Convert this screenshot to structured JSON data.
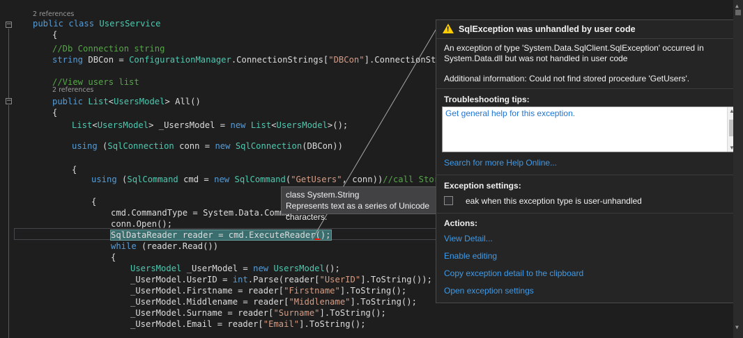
{
  "editor": {
    "ref_labels": [
      "2 references",
      "2 references"
    ],
    "lines": [
      [
        [
          "kw",
          "public class "
        ],
        [
          "ty",
          "UsersService"
        ]
      ],
      [
        [
          "",
          "{"
        ]
      ],
      [
        [
          "cm",
          "//Db Connection string"
        ]
      ],
      [
        [
          "kw",
          "string "
        ],
        [
          "",
          "DBCon = "
        ],
        [
          "ty",
          "ConfigurationManager"
        ],
        [
          "",
          ".ConnectionStrings["
        ],
        [
          "st",
          "\"DBCon\""
        ],
        [
          "",
          "].ConnectionString"
        ]
      ],
      [
        [
          "cm",
          "//View users list"
        ]
      ],
      [
        [
          "kw",
          "public "
        ],
        [
          "ty",
          "List"
        ],
        [
          "",
          "<"
        ],
        [
          "ty",
          "UsersModel"
        ],
        [
          "",
          "> All()"
        ]
      ],
      [
        [
          "",
          "{"
        ]
      ],
      [
        [
          "ty",
          "List"
        ],
        [
          "",
          "<"
        ],
        [
          "ty",
          "UsersModel"
        ],
        [
          "",
          "> _UsersModel = "
        ],
        [
          "kw",
          "new "
        ],
        [
          "ty",
          "List"
        ],
        [
          "",
          "<"
        ],
        [
          "ty",
          "UsersModel"
        ],
        [
          "",
          ">();"
        ]
      ],
      [
        [
          "kw",
          "using "
        ],
        [
          "",
          "("
        ],
        [
          "ty",
          "SqlConnection"
        ],
        [
          "",
          " conn = "
        ],
        [
          "kw",
          "new "
        ],
        [
          "ty",
          "SqlConnection"
        ],
        [
          "",
          "(DBCon))"
        ]
      ],
      [
        [
          "",
          "{"
        ]
      ],
      [
        [
          "kw",
          "using "
        ],
        [
          "",
          "("
        ],
        [
          "ty",
          "SqlCommand"
        ],
        [
          "",
          " cmd = "
        ],
        [
          "kw",
          "new "
        ],
        [
          "ty",
          "SqlCommand"
        ],
        [
          "",
          "("
        ],
        [
          "st",
          "\"GetUsers\""
        ],
        [
          "",
          ", conn))"
        ],
        [
          "cm",
          "//call Stored"
        ]
      ],
      [
        [
          "",
          "{"
        ]
      ],
      [
        [
          "",
          "cmd.CommandType = System.Data.Comma"
        ]
      ],
      [
        [
          "",
          "conn.Open();"
        ]
      ],
      [
        [
          "sel",
          "SqlDataReader reader = cmd.ExecuteReader();"
        ]
      ],
      [
        [
          "kw",
          "while "
        ],
        [
          "",
          "(reader.Read())"
        ]
      ],
      [
        [
          "",
          "{"
        ]
      ],
      [
        [
          "ty",
          "UsersModel"
        ],
        [
          "",
          " _UserModel = "
        ],
        [
          "kw",
          "new "
        ],
        [
          "ty",
          "UsersModel"
        ],
        [
          "",
          "();"
        ]
      ],
      [
        [
          "",
          "_UserModel.UserID = "
        ],
        [
          "kw",
          "int"
        ],
        [
          "",
          ".Parse(reader["
        ],
        [
          "st",
          "\"UserID\""
        ],
        [
          "",
          "].ToString());"
        ]
      ],
      [
        [
          "",
          "_UserModel.Firstname = reader["
        ],
        [
          "st",
          "\"Firstname\""
        ],
        [
          "",
          "].ToString();"
        ]
      ],
      [
        [
          "",
          "_UserModel.Middlename = reader["
        ],
        [
          "st",
          "\"Middlename\""
        ],
        [
          "",
          "].ToString();"
        ]
      ],
      [
        [
          "",
          "_UserModel.Surname = reader["
        ],
        [
          "st",
          "\"Surname\""
        ],
        [
          "",
          "].ToString();"
        ]
      ],
      [
        [
          "",
          "_UserModel.Email = reader["
        ],
        [
          "st",
          "\"Email\""
        ],
        [
          "",
          "].ToString();"
        ]
      ]
    ]
  },
  "tooltip": {
    "line1": "class System.String",
    "line2": "Represents text as a series of Unicode characters."
  },
  "exception": {
    "title": "SqlException was unhandled by user code",
    "close_glyph": "×",
    "warn_glyph": "!",
    "message_line1": "An exception of type 'System.Data.SqlClient.SqlException' occurred in",
    "message_line2": "System.Data.dll but was not handled in user code",
    "additional": "Additional information: Could not find stored procedure 'GetUsers'.",
    "tips_header": "Troubleshooting tips:",
    "tip_link": "Get general help for this exception.",
    "search_link": "Search for more Help Online...",
    "settings_header": "Exception settings:",
    "settings_option": "eak when this exception type is user-unhandled",
    "actions_header": "Actions:",
    "actions": [
      "View Detail...",
      "Enable editing",
      "Copy exception detail to the clipboard",
      "Open exception settings"
    ]
  },
  "colors": {
    "keyword": "#569cd6",
    "type": "#4ec9b0",
    "string": "#d69d85",
    "comment": "#57a64a",
    "link": "#3e9be9"
  }
}
